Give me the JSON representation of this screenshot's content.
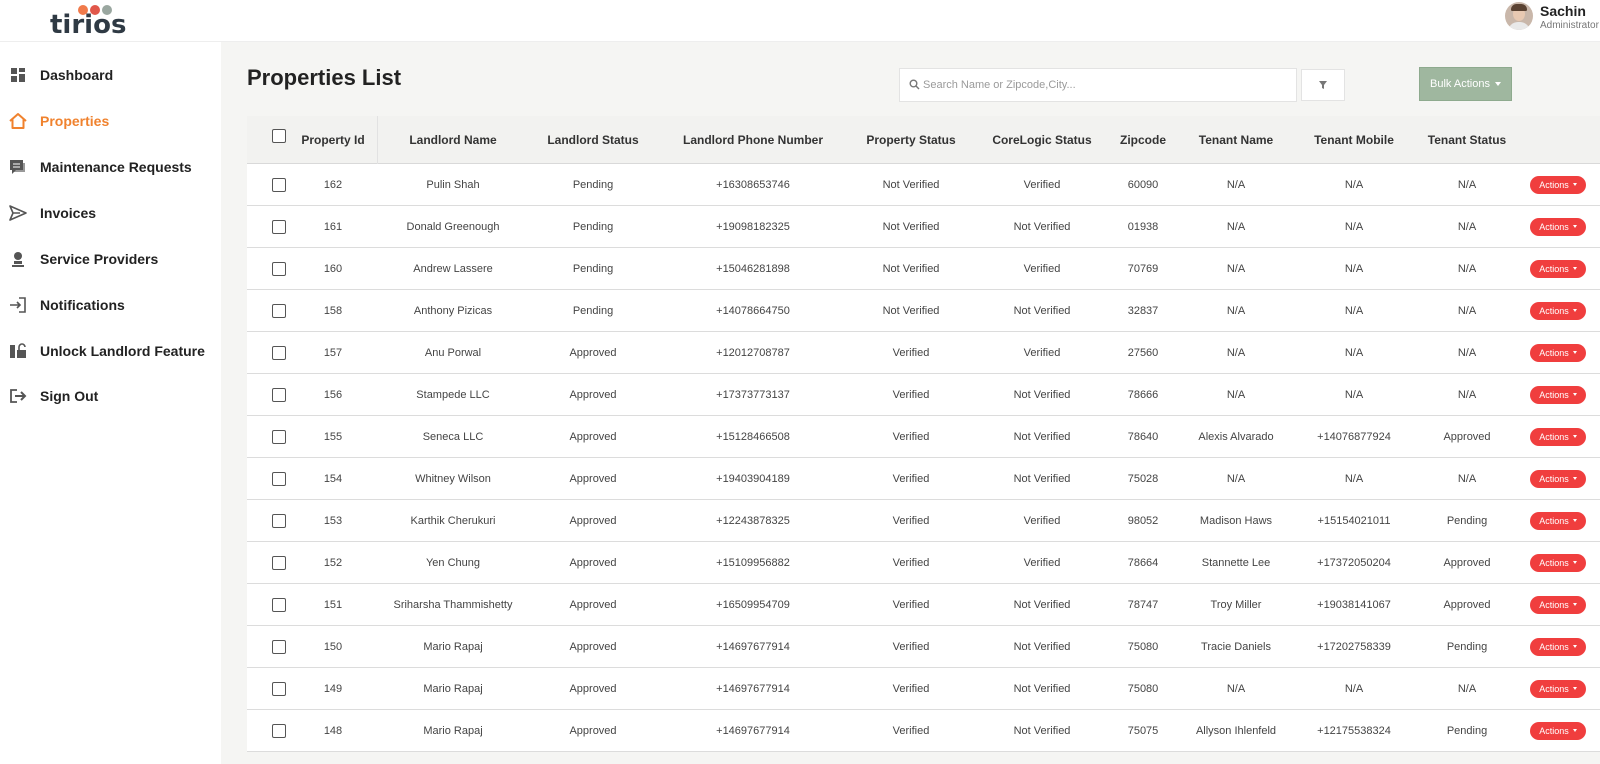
{
  "app": {
    "logo_text": "tirios"
  },
  "user": {
    "name": "Sachin",
    "role": "Administrator"
  },
  "sidebar": {
    "items": [
      {
        "label": "Dashboard",
        "icon": "dashboard-icon",
        "active": false
      },
      {
        "label": "Properties",
        "icon": "home-icon",
        "active": true
      },
      {
        "label": "Maintenance Requests",
        "icon": "chat-icon",
        "active": false
      },
      {
        "label": "Invoices",
        "icon": "send-icon",
        "active": false
      },
      {
        "label": "Service Providers",
        "icon": "person-icon",
        "active": false
      },
      {
        "label": "Notifications",
        "icon": "login-icon",
        "active": false
      },
      {
        "label": "Unlock Landlord Feature",
        "icon": "unlock-icon",
        "active": false
      },
      {
        "label": "Sign Out",
        "icon": "sign-out-icon",
        "active": false
      }
    ]
  },
  "main": {
    "title": "Properties List",
    "search_placeholder": "Search Name or Zipcode,City...",
    "bulk_actions_label": "Bulk Actions",
    "action_label": "Actions",
    "columns": [
      "Property Id",
      "Landlord Name",
      "Landlord Status",
      "Landlord Phone Number",
      "Property Status",
      "CoreLogic Status",
      "Zipcode",
      "Tenant Name",
      "Tenant Mobile",
      "Tenant Status"
    ],
    "rows": [
      [
        "162",
        "Pulin Shah",
        "Pending",
        "+16308653746",
        "Not Verified",
        "Verified",
        "60090",
        "N/A",
        "N/A",
        "N/A"
      ],
      [
        "161",
        "Donald Greenough",
        "Pending",
        "+19098182325",
        "Not Verified",
        "Not Verified",
        "01938",
        "N/A",
        "N/A",
        "N/A"
      ],
      [
        "160",
        "Andrew Lassere",
        "Pending",
        "+15046281898",
        "Not Verified",
        "Verified",
        "70769",
        "N/A",
        "N/A",
        "N/A"
      ],
      [
        "158",
        "Anthony Pizicas",
        "Pending",
        "+14078664750",
        "Not Verified",
        "Not Verified",
        "32837",
        "N/A",
        "N/A",
        "N/A"
      ],
      [
        "157",
        "Anu Porwal",
        "Approved",
        "+12012708787",
        "Verified",
        "Verified",
        "27560",
        "N/A",
        "N/A",
        "N/A"
      ],
      [
        "156",
        "Stampede LLC",
        "Approved",
        "+17373773137",
        "Verified",
        "Not Verified",
        "78666",
        "N/A",
        "N/A",
        "N/A"
      ],
      [
        "155",
        "Seneca LLC",
        "Approved",
        "+15128466508",
        "Verified",
        "Not Verified",
        "78640",
        "Alexis Alvarado",
        "+14076877924",
        "Approved"
      ],
      [
        "154",
        "Whitney Wilson",
        "Approved",
        "+19403904189",
        "Verified",
        "Not Verified",
        "75028",
        "N/A",
        "N/A",
        "N/A"
      ],
      [
        "153",
        "Karthik Cherukuri",
        "Approved",
        "+12243878325",
        "Verified",
        "Verified",
        "98052",
        "Madison Haws",
        "+15154021011",
        "Pending"
      ],
      [
        "152",
        "Yen Chung",
        "Approved",
        "+15109956882",
        "Verified",
        "Verified",
        "78664",
        "Stannette Lee",
        "+17372050204",
        "Approved"
      ],
      [
        "151",
        "Sriharsha Thammishetty",
        "Approved",
        "+16509954709",
        "Verified",
        "Not Verified",
        "78747",
        "Troy Miller",
        "+19038141067",
        "Approved"
      ],
      [
        "150",
        "Mario Rapaj",
        "Approved",
        "+14697677914",
        "Verified",
        "Not Verified",
        "75080",
        "Tracie Daniels",
        "+17202758339",
        "Pending"
      ],
      [
        "149",
        "Mario Rapaj",
        "Approved",
        "+14697677914",
        "Verified",
        "Not Verified",
        "75080",
        "N/A",
        "N/A",
        "N/A"
      ],
      [
        "148",
        "Mario Rapaj",
        "Approved",
        "+14697677914",
        "Verified",
        "Not Verified",
        "75075",
        "Allyson Ihlenfeld",
        "+12175538324",
        "Pending"
      ]
    ]
  },
  "colors": {
    "accent": "#f0822e",
    "action_button": "#f03e3e",
    "bulk_button": "#9fb79f"
  }
}
